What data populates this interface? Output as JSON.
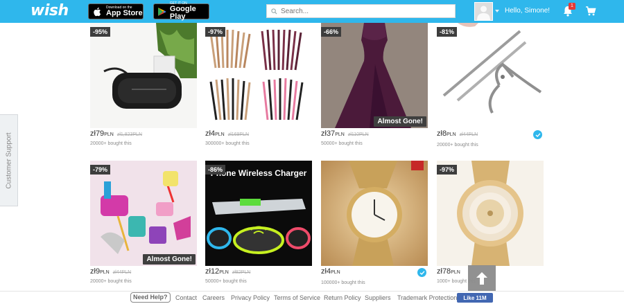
{
  "header": {
    "logo": "wish",
    "appstore": {
      "small": "Download on the",
      "big": "App Store"
    },
    "googleplay": {
      "small": "GET IT ON",
      "big": "Google Play"
    },
    "search_placeholder": "Search...",
    "greeting": "Hello, Simone!",
    "notification_count": "1"
  },
  "side": {
    "support_label": "Customer Support"
  },
  "products": [
    {
      "discount": "-95%",
      "price": "zł79",
      "currency": "PLN",
      "old_price": "zł1,823PLN",
      "bought": "20000+ bought this",
      "almost_gone": "",
      "verified": false
    },
    {
      "discount": "-97%",
      "price": "zł4",
      "currency": "PLN",
      "old_price": "zł169PLN",
      "bought": "300000+ bought this",
      "almost_gone": "",
      "verified": false
    },
    {
      "discount": "-66%",
      "price": "zł37",
      "currency": "PLN",
      "old_price": "zł110PLN",
      "bought": "50000+ bought this",
      "almost_gone": "Almost Gone!",
      "verified": false
    },
    {
      "discount": "-81%",
      "price": "zł8",
      "currency": "PLN",
      "old_price": "zł44PLN",
      "bought": "20000+ bought this",
      "almost_gone": "",
      "verified": true
    },
    {
      "discount": "-79%",
      "price": "zł9",
      "currency": "PLN",
      "old_price": "zł44PLN",
      "bought": "20000+ bought this",
      "almost_gone": "Almost Gone!",
      "verified": false
    },
    {
      "discount": "-86%",
      "price": "zł12",
      "currency": "PLN",
      "old_price": "zł82PLN",
      "bought": "50000+ bought this",
      "almost_gone": "",
      "verified": false,
      "image_text": "Phone Wireless Charger"
    },
    {
      "discount": "",
      "price": "zł4",
      "currency": "PLN",
      "old_price": "",
      "bought": "100000+ bought this",
      "almost_gone": "",
      "verified": true
    },
    {
      "discount": "-97%",
      "price": "zł78",
      "currency": "PLN",
      "old_price": "",
      "bought": "1000+ bought this",
      "almost_gone": "",
      "verified": false
    }
  ],
  "footer": {
    "need_help": "Need Help?",
    "links": [
      "Contact",
      "Careers",
      "Privacy Policy",
      "Terms of Service",
      "Return Policy",
      "Suppliers",
      "Trademark Protection"
    ],
    "like_label": "Like 11M"
  },
  "colors": {
    "brand": "#2fb7ec",
    "badge": "#3d3d3d",
    "check": "#2fb7ec"
  }
}
